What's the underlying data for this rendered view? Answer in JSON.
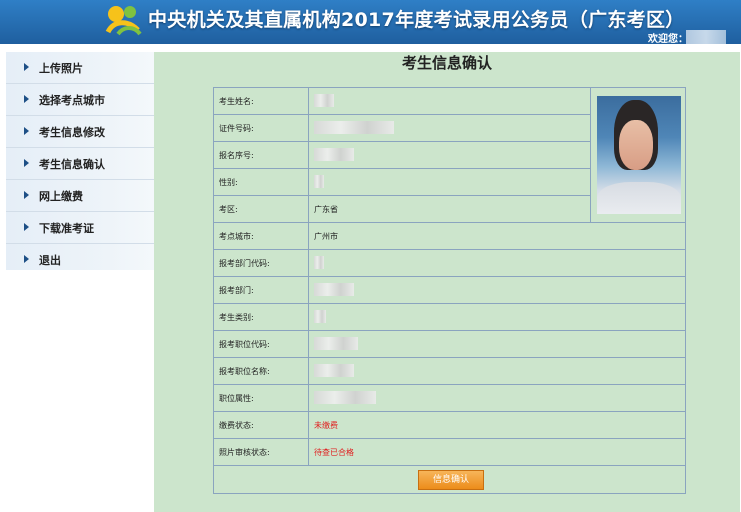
{
  "header": {
    "title": "中央机关及其直属机构2017年度考试录用公务员（广东考区）",
    "welcome": "欢迎您："
  },
  "sidebar": {
    "items": [
      {
        "label": "上传照片"
      },
      {
        "label": "选择考点城市"
      },
      {
        "label": "考生信息修改"
      },
      {
        "label": "考生信息确认"
      },
      {
        "label": "网上缴费"
      },
      {
        "label": "下载准考证"
      },
      {
        "label": "退出"
      }
    ]
  },
  "main": {
    "title": "考生信息确认",
    "fields": [
      {
        "label": "考生姓名:",
        "value": ""
      },
      {
        "label": "证件号码:",
        "value": ""
      },
      {
        "label": "报名序号:",
        "value": ""
      },
      {
        "label": "性别:",
        "value": ""
      },
      {
        "label": "考区:",
        "value": "广东省"
      },
      {
        "label": "考点城市:",
        "value": "广州市"
      },
      {
        "label": "报考部门代码:",
        "value": ""
      },
      {
        "label": "报考部门:",
        "value": ""
      },
      {
        "label": "考生类别:",
        "value": ""
      },
      {
        "label": "报考职位代码:",
        "value": ""
      },
      {
        "label": "报考职位名称:",
        "value": ""
      },
      {
        "label": "职位属性:",
        "value": ""
      },
      {
        "label": "缴费状态:",
        "value": "未缴费"
      },
      {
        "label": "照片审核状态:",
        "value": "待查已合格"
      }
    ],
    "confirm_button": "信息确认"
  },
  "colors": {
    "header_bg": "#2f7fc6",
    "main_bg": "#cce5cc",
    "status_red": "#e02020",
    "button_orange": "#ec8c1a"
  }
}
